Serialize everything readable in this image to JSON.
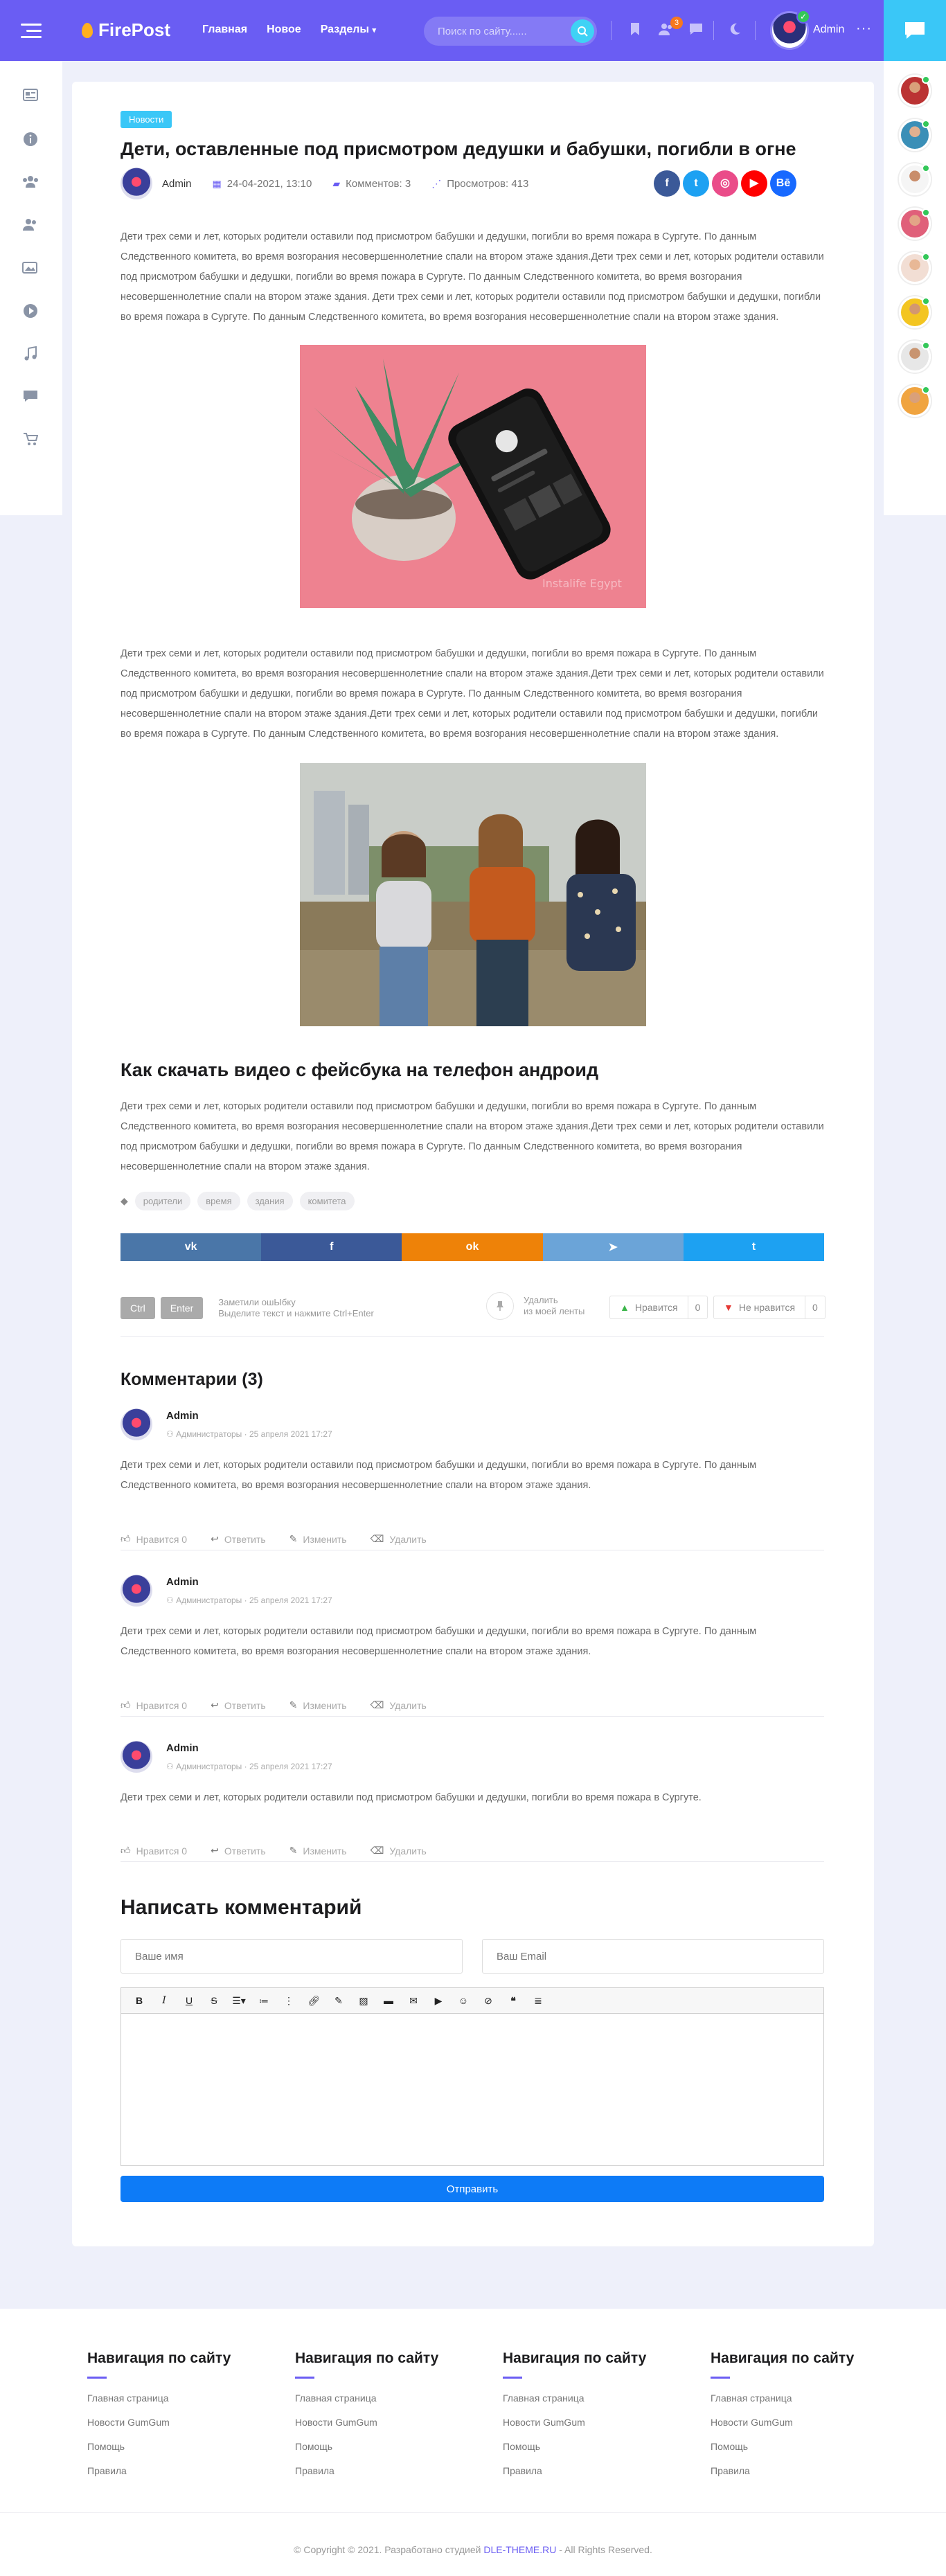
{
  "header": {
    "logo": "FirePost",
    "nav": [
      "Главная",
      "Новое",
      "Разделы"
    ],
    "search_placeholder": "Поиск по сайту......",
    "notif_count": "3",
    "user": "Admin"
  },
  "article": {
    "tag": "Новости",
    "title": "Дети, оставленные под присмотром дедушки и бабушки, погибли в огне",
    "author": "Admin",
    "date": "24-04-2021, 13:10",
    "comments": "Комментов: 3",
    "views": "Просмотров: 413",
    "share": [
      {
        "name": "facebook",
        "color": "#3b5998",
        "glyph": "f"
      },
      {
        "name": "twitter",
        "color": "#1da1f2",
        "glyph": "t"
      },
      {
        "name": "dribbble",
        "color": "#ea4c89",
        "glyph": "◎"
      },
      {
        "name": "youtube",
        "color": "#ff0000",
        "glyph": "▶"
      },
      {
        "name": "behance",
        "color": "#1769ff",
        "glyph": "Bē"
      }
    ],
    "para1": "Дети трех семи и лет, которых родители оставили под присмотром бабушки и дедушки, погибли во время пожара в Сургуте. По данным Следственного комитета, во время возгорания несовершеннолетние спали на втором этаже здания.Дети трех семи и лет, которых родители оставили под присмотром бабушки и дедушки, погибли во время пожара в Сургуте. По данным Следственного комитета, во время возгорания несовершеннолетние спали на втором этаже здания. Дети трех семи и лет, которых родители оставили под присмотром бабушки и дедушки, погибли во время пожара в Сургуте. По данным Следственного комитета, во время возгорания несовершеннолетние спали на втором этаже здания.",
    "img1_caption": "Instalife Egypt",
    "para2": "Дети трех семи и лет, которых родители оставили под присмотром бабушки и дедушки, погибли во время пожара в Сургуте. По данным Следственного комитета, во время возгорания несовершеннолетние спали на втором этаже здания.Дети трех семи и лет, которых родители оставили под присмотром бабушки и дедушки, погибли во время пожара в Сургуте. По данным Следственного комитета, во время возгорания несовершеннолетние спали на втором этаже здания.Дети трех семи и лет, которых родители оставили под присмотром бабушки и дедушки, погибли во время пожара в Сургуте. По данным Следственного комитета, во время возгорания несовершеннолетние спали на втором этаже здания.",
    "subtitle": "Как скачать видео с фейсбука на телефон андроид",
    "para3": "Дети трех семи и лет, которых родители оставили под присмотром бабушки и дедушки, погибли во время пожара в Сургуте. По данным Следственного комитета, во время возгорания несовершеннолетние спали на втором этаже здания.Дети трех семи и лет, которых родители оставили под присмотром бабушки и дедушки, погибли во время пожара в Сургуте. По данным Следственного комитета, во время возгорания несовершеннолетние спали на втором этаже здания.",
    "tags": [
      "родители",
      "время",
      "здания",
      "комитета"
    ],
    "sharebar": [
      {
        "name": "vk",
        "color": "#4a76a8",
        "glyph": "vk"
      },
      {
        "name": "facebook",
        "color": "#3b5998",
        "glyph": "f"
      },
      {
        "name": "odnoklassniki",
        "color": "#ee8208",
        "glyph": "ok"
      },
      {
        "name": "telegram",
        "color": "#6ba4d8",
        "glyph": "➤"
      },
      {
        "name": "twitter",
        "color": "#1da1f2",
        "glyph": "t"
      }
    ],
    "key1": "Ctrl",
    "key2": "Enter",
    "hint1": "Заметили ошЫбку",
    "hint2": "Выделите текст и нажмите Ctrl+Enter",
    "del1": "Удалить",
    "del2": "из моей ленты",
    "like": "Нравится",
    "like_count": "0",
    "dislike": "Не нравится",
    "dislike_count": "0"
  },
  "comments": {
    "title": "Комментарии (3)",
    "items": [
      {
        "name": "Admin",
        "role": "Администраторы",
        "date": "25 апреля 2021 17:27",
        "text": "Дети трех семи и лет, которых родители оставили под присмотром бабушки и дедушки, погибли во время пожара в Сургуте. По данным Следственного комитета, во время возгорания несовершеннолетние спали на втором этаже здания.",
        "likes": "Нравится 0",
        "reply": "Ответить",
        "edit": "Изменить",
        "delete": "Удалить"
      },
      {
        "name": "Admin",
        "role": "Администраторы",
        "date": "25 апреля 2021 17:27",
        "text": "Дети трех семи и лет, которых родители оставили под присмотром бабушки и дедушки, погибли во время пожара в Сургуте. По данным Следственного комитета, во время возгорания несовершеннолетние спали на втором этаже здания.",
        "likes": "Нравится 0",
        "reply": "Ответить",
        "edit": "Изменить",
        "delete": "Удалить"
      },
      {
        "name": "Admin",
        "role": "Администраторы",
        "date": "25 апреля 2021 17:27",
        "text": "Дети трех семи и лет, которых родители оставили под присмотром бабушки и дедушки, погибли во время пожара в Сургуте.",
        "likes": "Нравится 0",
        "reply": "Ответить",
        "edit": "Изменить",
        "delete": "Удалить"
      }
    ]
  },
  "form": {
    "title": "Написать комментарий",
    "name_placeholder": "Ваше имя",
    "email_placeholder": "Ваш Email",
    "submit": "Отправить"
  },
  "footer": {
    "columns": [
      {
        "title": "Навигация по сайту",
        "links": [
          "Главная страница",
          "Новости GumGum",
          "Помощь",
          "Правила"
        ]
      },
      {
        "title": "Навигация по сайту",
        "links": [
          "Главная страница",
          "Новости GumGum",
          "Помощь",
          "Правила"
        ]
      },
      {
        "title": "Навигация по сайту",
        "links": [
          "Главная страница",
          "Новости GumGum",
          "Помощь",
          "Правила"
        ]
      },
      {
        "title": "Навигация по сайту",
        "links": [
          "Главная страница",
          "Новости GumGum",
          "Помощь",
          "Правила"
        ]
      }
    ],
    "copy_pre": "© Copyright © 2021. Разработано студией",
    "copy_link": "DLE-THEME.RU",
    "copy_post": "- All Rights Reserved."
  }
}
